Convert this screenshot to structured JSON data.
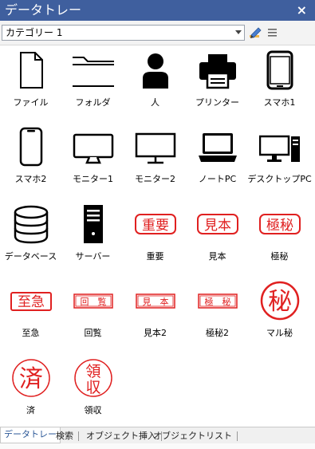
{
  "window": {
    "title": "データトレー",
    "close_glyph": "×"
  },
  "toolbar": {
    "category_value": "カテゴリー 1",
    "edit_icon": "pencil-edit-icon",
    "menu_icon": "hamburger-menu-icon"
  },
  "items": [
    {
      "label": "ファイル",
      "icon": "file-icon"
    },
    {
      "label": "フォルダ",
      "icon": "folder-icon"
    },
    {
      "label": "人",
      "icon": "person-icon"
    },
    {
      "label": "プリンター",
      "icon": "printer-icon"
    },
    {
      "label": "スマホ1",
      "icon": "smartphone-icon"
    },
    {
      "label": "スマホ2",
      "icon": "smartphone-outline-icon"
    },
    {
      "label": "モニター1",
      "icon": "monitor-icon"
    },
    {
      "label": "モニター2",
      "icon": "monitor-thin-icon"
    },
    {
      "label": "ノートPC",
      "icon": "laptop-icon"
    },
    {
      "label": "デスクトップPC",
      "icon": "desktop-pc-icon"
    },
    {
      "label": "データベース",
      "icon": "database-icon"
    },
    {
      "label": "サーバー",
      "icon": "server-icon"
    },
    {
      "label": "重要",
      "icon": "stamp-juyo-icon",
      "stamp_text": "重要"
    },
    {
      "label": "見本",
      "icon": "stamp-mihon-icon",
      "stamp_text": "見本"
    },
    {
      "label": "極秘",
      "icon": "stamp-gokuhi-icon",
      "stamp_text": "極秘"
    },
    {
      "label": "至急",
      "icon": "stamp-shikyu-icon",
      "stamp_text": "至急"
    },
    {
      "label": "回覧",
      "icon": "stamp-kairan-icon",
      "stamp_text": "回　覧"
    },
    {
      "label": "見本2",
      "icon": "stamp-mihon2-icon",
      "stamp_text": "見　本"
    },
    {
      "label": "極秘2",
      "icon": "stamp-gokuhi2-icon",
      "stamp_text": "極　秘"
    },
    {
      "label": "マル秘",
      "icon": "stamp-maruhi-icon",
      "stamp_text": "秘"
    },
    {
      "label": "済",
      "icon": "stamp-zumi-icon",
      "stamp_text": "済"
    },
    {
      "label": "領収",
      "icon": "stamp-ryoshu-icon",
      "stamp_text_1": "領",
      "stamp_text_2": "収"
    }
  ],
  "tabs": [
    {
      "label": "データトレー",
      "active": true
    },
    {
      "label": "検索",
      "active": false
    },
    {
      "label": "オブジェクト挿入",
      "active": false
    },
    {
      "label": "オブジェクトリスト",
      "active": false
    }
  ],
  "colors": {
    "titlebar": "#3f5f9e",
    "stamp_red": "#e02020",
    "tab_active_text": "#2b5797"
  }
}
